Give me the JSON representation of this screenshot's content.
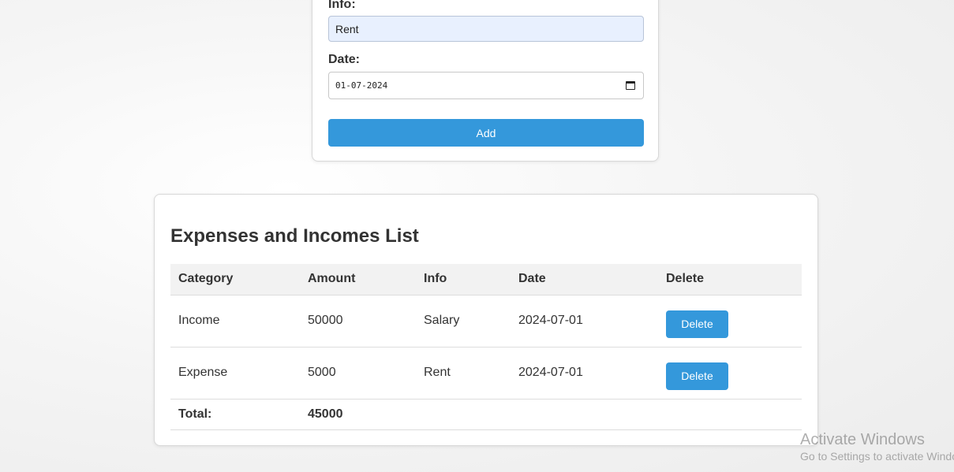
{
  "form": {
    "info_label": "Info:",
    "info_value": "Rent",
    "date_label": "Date:",
    "date_value": "01-07-2024",
    "add_label": "Add"
  },
  "list": {
    "title": "Expenses and Incomes List",
    "columns": [
      "Category",
      "Amount",
      "Info",
      "Date",
      "Delete"
    ],
    "rows": [
      {
        "category": "Income",
        "amount": "50000",
        "info": "Salary",
        "date": "2024-07-01",
        "action": "Delete"
      },
      {
        "category": "Expense",
        "amount": "5000",
        "info": "Rent",
        "date": "2024-07-01",
        "action": "Delete"
      }
    ],
    "total_label": "Total:",
    "total_value": "45000"
  },
  "watermark": {
    "title": "Activate Windows",
    "subtitle": "Go to Settings to activate Windows."
  },
  "icons": {
    "date_picker": "calendar-icon"
  },
  "colors": {
    "accent": "#3498db",
    "autofill": "#e8f0fe"
  }
}
